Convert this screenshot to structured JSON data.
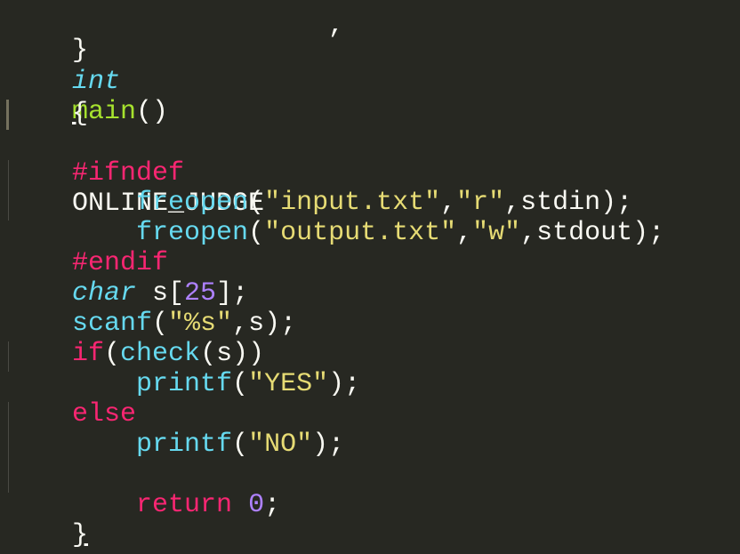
{
  "code": {
    "top_partial": ",",
    "close_brace_top": "}",
    "main_type": "int",
    "main_name": "main",
    "main_parens": "()",
    "open_brace": "{",
    "ifndef_directive": "#ifndef",
    "ifndef_macro": "ONLINE_JUDGE",
    "freopen1_fn": "freopen",
    "freopen1_open": "(",
    "freopen1_file": "\"input.txt\"",
    "freopen1_comma1": ",",
    "freopen1_mode": "\"r\"",
    "freopen1_rest": ",stdin);",
    "freopen2_fn": "freopen",
    "freopen2_open": "(",
    "freopen2_file": "\"output.txt\"",
    "freopen2_comma1": ",",
    "freopen2_mode": "\"w\"",
    "freopen2_rest": ",stdout);",
    "endif_directive": "#endif",
    "char_type": "char",
    "char_var": " s[",
    "char_size": "25",
    "char_end": "];",
    "scanf_fn": "scanf",
    "scanf_open": "(",
    "scanf_fmt": "\"%s\"",
    "scanf_rest": ",s);",
    "if_kw": "if",
    "if_open": "(",
    "check_fn": "check",
    "if_rest": "(s))",
    "printf_yes_fn": "printf",
    "printf_yes_open": "(",
    "printf_yes_str": "\"YES\"",
    "printf_yes_end": ");",
    "else_kw": "else",
    "printf_no_fn": "printf",
    "printf_no_open": "(",
    "printf_no_str": "\"NO\"",
    "printf_no_end": ");",
    "return_kw": "return",
    "return_val": "0",
    "return_end": ";",
    "close_brace_bottom": "}"
  },
  "theme": {
    "background": "#272822",
    "keyword": "#f92672",
    "type": "#66d9ef",
    "function_def": "#a6e22e",
    "string": "#e6db74",
    "number": "#ae81ff",
    "plain": "#f8f8f2"
  }
}
